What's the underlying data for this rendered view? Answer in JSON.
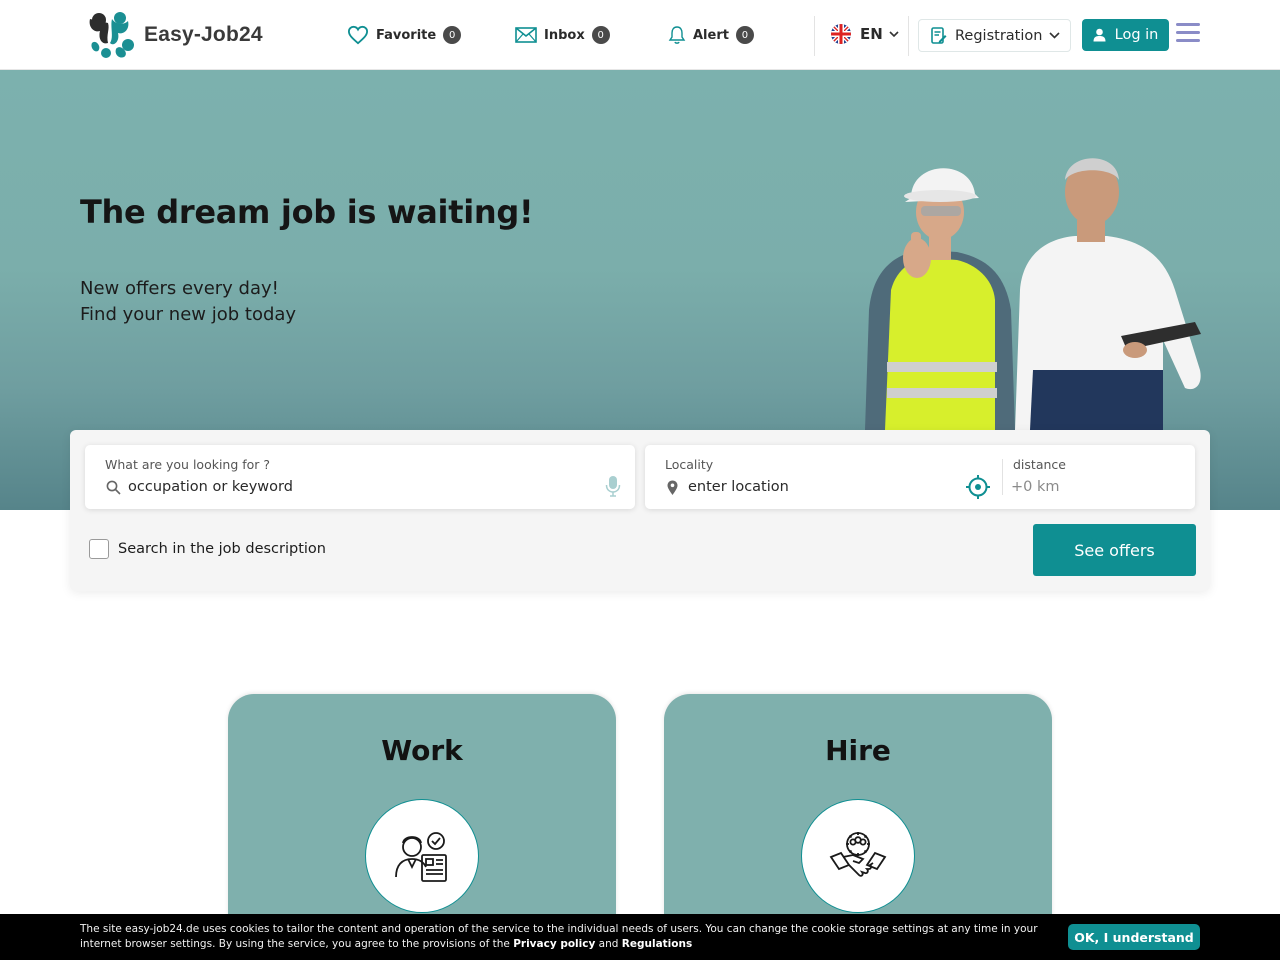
{
  "brand": {
    "name": "Easy-Job24",
    "accent": "#0f8f92",
    "hero_bg": "#7cb1ae"
  },
  "header": {
    "favorite": {
      "label": "Favorite",
      "count": "0",
      "icon": "heart-icon"
    },
    "inbox": {
      "label": "Inbox",
      "count": "0",
      "icon": "envelope-icon"
    },
    "alert": {
      "label": "Alert",
      "count": "0",
      "icon": "bell-icon"
    },
    "language": {
      "code": "EN",
      "icon": "uk-flag-icon"
    },
    "registration": {
      "label": "Registration",
      "icon": "form-edit-icon"
    },
    "login": {
      "label": "Log in",
      "icon": "user-icon"
    },
    "menu_icon": "hamburger-menu-icon"
  },
  "hero": {
    "title": "The dream job is waiting!",
    "subtitle_line1": "New offers every day!",
    "subtitle_line2": "Find your new job today"
  },
  "search": {
    "what_label": "What are you looking for ?",
    "what_placeholder": "occupation or keyword",
    "locality_label": "Locality",
    "locality_placeholder": "enter location",
    "distance_label": "distance",
    "distance_placeholder": "+0 km",
    "description_checkbox_label": "Search in the job description",
    "description_checked": false,
    "submit_label": "See offers"
  },
  "cards": {
    "work": {
      "title": "Work",
      "icon": "worker-cv-icon"
    },
    "hire": {
      "title": "Hire",
      "icon": "handshake-team-icon"
    }
  },
  "cookie": {
    "text_prefix": "The site easy-job24.de uses cookies to tailor the content and operation of the service to the individual needs of users. You can change the cookie storage settings at any time in your internet browser settings. By using the service, you agree to the provisions of the",
    "privacy_link": "Privacy policy",
    "and_text": "and",
    "regulations_link": "Regulations",
    "button_label": "OK, I understand"
  }
}
